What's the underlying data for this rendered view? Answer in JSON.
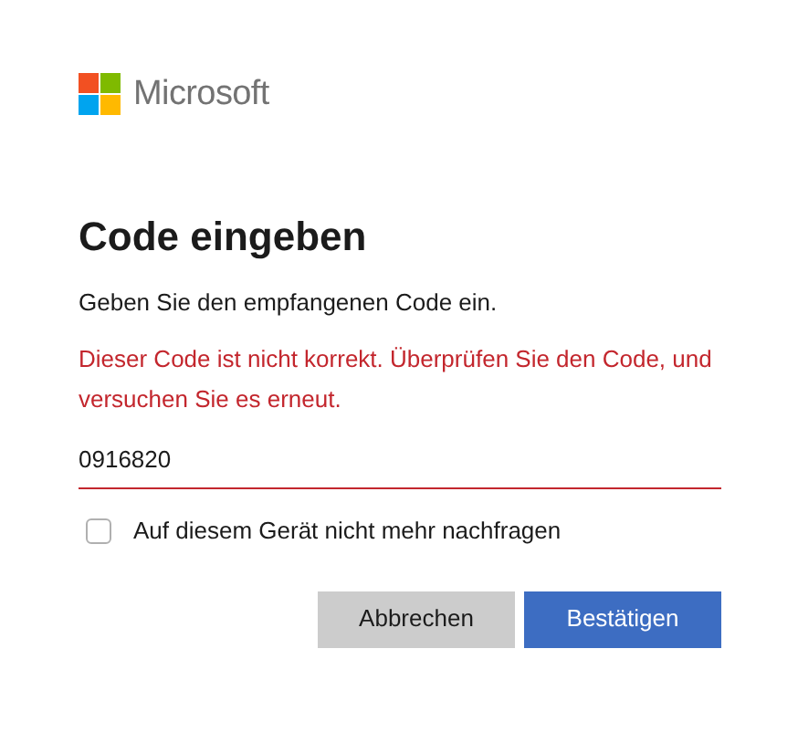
{
  "brand": "Microsoft",
  "title": "Code eingeben",
  "description": "Geben Sie den empfangenen Code ein.",
  "error": "Dieser Code ist nicht korrekt. Überprüfen Sie den Code, und versuchen Sie es erneut.",
  "code_field": {
    "value": "0916820",
    "invalid": true
  },
  "remember": {
    "label": "Auf diesem Gerät nicht mehr nachfragen",
    "checked": false
  },
  "buttons": [
    {
      "label": "Abbrechen",
      "kind": "secondary"
    },
    {
      "label": "Bestätigen",
      "kind": "primary"
    }
  ]
}
